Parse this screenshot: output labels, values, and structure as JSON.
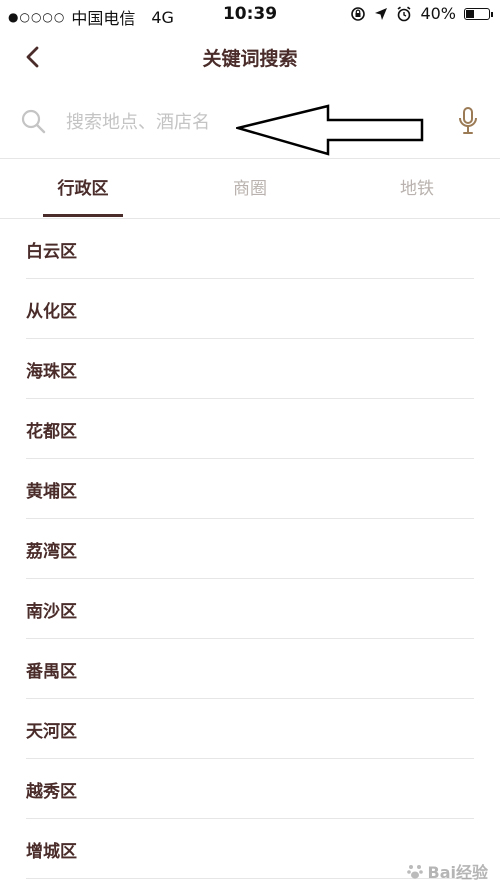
{
  "status_bar": {
    "signal": "●○○○○",
    "carrier": "中国电信",
    "network": "4G",
    "time": "10:39",
    "battery_text": "40%",
    "battery_level": 0.4
  },
  "nav": {
    "title": "关键词搜索"
  },
  "search": {
    "placeholder": "搜索地点、酒店名",
    "value": ""
  },
  "tabs": [
    {
      "label": "行政区",
      "active": true
    },
    {
      "label": "商圈",
      "active": false
    },
    {
      "label": "地铁",
      "active": false
    }
  ],
  "districts": [
    "白云区",
    "从化区",
    "海珠区",
    "花都区",
    "黄埔区",
    "荔湾区",
    "南沙区",
    "番禺区",
    "天河区",
    "越秀区",
    "增城区"
  ],
  "watermark": {
    "text": "Bai经验"
  },
  "colors": {
    "accent": "#4a2c2a",
    "inactive_tab": "#b9b2ae",
    "divider": "#e6e6e6",
    "placeholder": "#c4c4c4",
    "mic": "#9b7b56"
  }
}
